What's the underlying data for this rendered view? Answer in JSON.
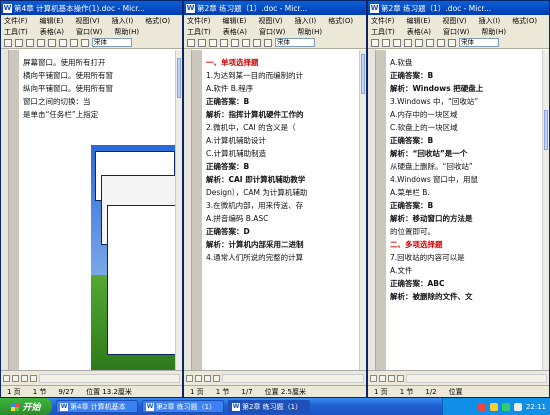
{
  "windows": [
    {
      "title": "第4章 计算机基本操作(1).doc - Micr...",
      "menu1": [
        "文件(F)",
        "编辑(E)",
        "视图(V)",
        "插入(I)",
        "格式(O)"
      ],
      "menu2": [
        "工具(T)",
        "表格(A)",
        "窗口(W)",
        "帮助(H)"
      ],
      "font": "宋体",
      "lines": [
        "屏幕窗口。使用所有打开",
        " ",
        " ",
        " ",
        " ",
        " ",
        " ",
        " ",
        " ",
        " ",
        " ",
        " ",
        " ",
        " ",
        " ",
        " ",
        " ",
        " ",
        " ",
        " ",
        "横向平铺窗口。使用所有窗",
        "纵向平铺窗口。使用所有窗",
        "窗口之间的切换：当",
        "是单击“任务栏”上指定"
      ],
      "status": {
        "page": "1 页",
        "section": "1 节",
        "pos": "9/27",
        "at": "位置 13.2厘米"
      }
    },
    {
      "title": "第2章 练习题（1）.doc - Micr...",
      "menu1": [
        "文件(F)",
        "编辑(E)",
        "视图(V)",
        "插入(I)",
        "格式(O)"
      ],
      "menu2": [
        "工具(T)",
        "表格(A)",
        "窗口(W)",
        "帮助(H)"
      ],
      "font": "宋体",
      "lines": [
        " ",
        " ",
        " ",
        "一、单项选择题",
        "1.为达到某一目的而编制的计",
        "A.软件            B.程序",
        "正确答案：B",
        "解析：指挥计算机硬件工作的",
        "",
        "2.微机中，CAI 的含义是（",
        "A.计算机辅助设计",
        "C.计算机辅助制造",
        "正确答案：B",
        "解析：CAI 即计算机辅助教学",
        "Design），CAM 为计算机辅助",
        "",
        "3.在微机内部，用来传送、存",
        "A.拼音编码      B.ASC",
        "正确答案：D",
        "解析：计算机内部采用二进制",
        "",
        "4.通常人们所说的完整的计算"
      ],
      "status": {
        "page": "1 页",
        "section": "1 节",
        "pos": "1/7",
        "at": "位置 2.5厘米"
      }
    },
    {
      "title": "第2章 练习题（1）.doc - Micr...",
      "menu1": [
        "文件(F)",
        "编辑(E)",
        "视图(V)",
        "插入(I)",
        "格式(O)"
      ],
      "menu2": [
        "工具(T)",
        "表格(A)",
        "窗口(W)",
        "帮助(H)"
      ],
      "font": "宋体",
      "lines": [
        "A.软盘",
        "正确答案：B",
        "解析：Windows 把硬盘上",
        "",
        "3.Windows 中，“回收站”",
        "A.内存中的一块区域",
        "C.软盘上的一块区域",
        "正确答案：B",
        "解析：“回收站”是一个",
        "从硬盘上删除。“回收站”",
        "",
        "4.Windows 窗口中，用鼠",
        "A.菜单栏       B.",
        "正确答案：B",
        "解析：移动窗口的方法是",
        "的位置即可。",
        "",
        "二、多项选择题",
        "7.回收站的内容可以是",
        "A.文件",
        "正确答案：ABC",
        "解析：被删除的文件、文"
      ],
      "status": {
        "page": "1 页",
        "section": "1 节",
        "pos": "1/2",
        "at": "位置"
      }
    }
  ],
  "taskbar": {
    "start": "开始",
    "buttons": [
      "第4章 计算机基本",
      "第2章 练习题（1）",
      "第2章 练习题（1）"
    ],
    "clock": "22:11"
  },
  "colors": {
    "titlebar": "#0a5fd8",
    "taskbar": "#1f5fd0",
    "start": "#3db53d"
  }
}
